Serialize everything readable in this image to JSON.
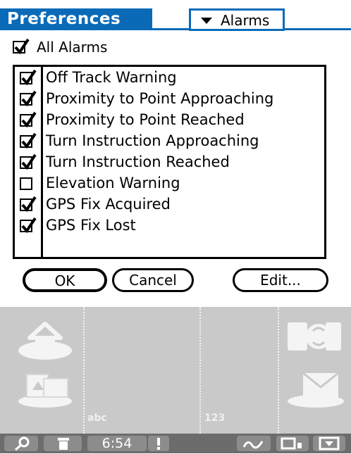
{
  "header": {
    "title": "Preferences",
    "category_selector": "Alarms"
  },
  "all_alarms": {
    "label": "All Alarms",
    "checked": true
  },
  "alarms": [
    {
      "label": "Off Track Warning",
      "checked": true
    },
    {
      "label": "Proximity to Point Approaching",
      "checked": true
    },
    {
      "label": "Proximity to Point Reached",
      "checked": true
    },
    {
      "label": "Turn Instruction Approaching",
      "checked": true
    },
    {
      "label": "Turn  Instruction Reached",
      "checked": true
    },
    {
      "label": "Elevation Warning",
      "checked": false
    },
    {
      "label": "GPS Fix Acquired",
      "checked": true
    },
    {
      "label": "GPS Fix Lost",
      "checked": true
    }
  ],
  "buttons": {
    "ok": "OK",
    "cancel": "Cancel",
    "edit": "Edit..."
  },
  "graffiti": {
    "left_label": "abc",
    "right_label": "123"
  },
  "status": {
    "time": "6:54"
  },
  "colors": {
    "accent": "#0a6ab8",
    "graffiti_bg": "#c9c9c9",
    "statusbar_bg": "#6c6c6c"
  }
}
